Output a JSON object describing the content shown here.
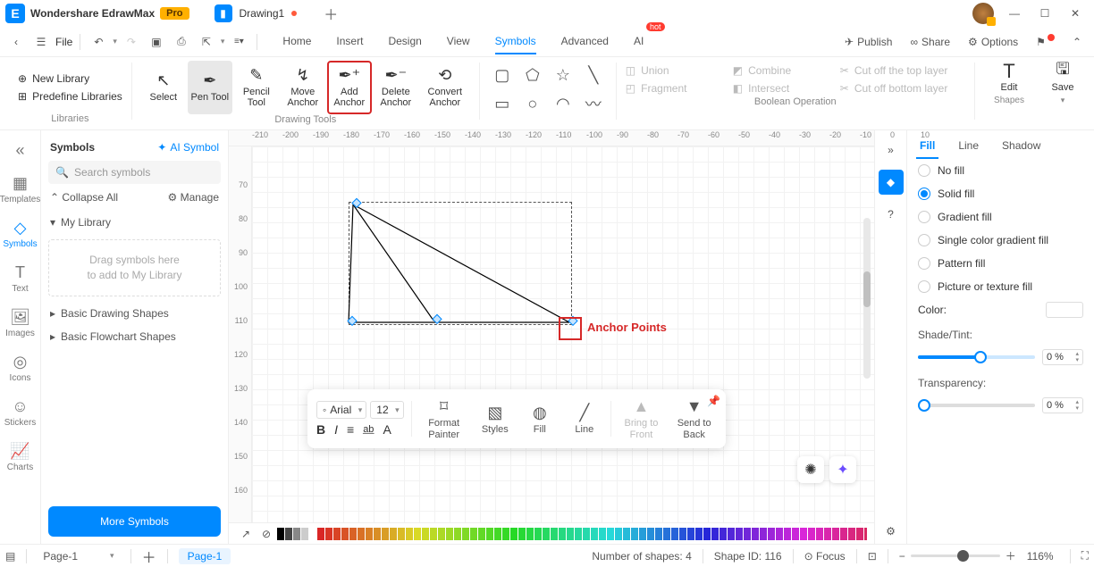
{
  "titlebar": {
    "app": "Wondershare EdrawMax",
    "badge": "Pro",
    "tab": "Drawing1"
  },
  "menubar": {
    "file": "File",
    "tabs": [
      "Home",
      "Insert",
      "Design",
      "View",
      "Symbols",
      "Advanced",
      "AI"
    ],
    "active": "Symbols",
    "hot": "hot",
    "publish": "Publish",
    "share": "Share",
    "options": "Options"
  },
  "ribbon": {
    "libraries": {
      "title": "Libraries",
      "new": "New Library",
      "predefine": "Predefine Libraries"
    },
    "drawing_tools": {
      "title": "Drawing Tools",
      "select": "Select",
      "pen": "Pen Tool",
      "pencil": "Pencil Tool",
      "move": "Move Anchor",
      "add": "Add Anchor",
      "del": "Delete Anchor",
      "convert": "Convert Anchor"
    },
    "bool": {
      "title": "Boolean Operation",
      "union": "Union",
      "fragment": "Fragment",
      "combine": "Combine",
      "intersect": "Intersect",
      "cuttop": "Cut off the top layer",
      "cutbottom": "Cut off bottom layer"
    },
    "rtools": {
      "edit": "Edit",
      "shapes": "Shapes",
      "save": "Save"
    }
  },
  "vtabs": [
    "Templates",
    "Symbols",
    "Text",
    "Images",
    "Icons",
    "Stickers",
    "Charts"
  ],
  "side": {
    "title": "Symbols",
    "ai": "AI Symbol",
    "placeholder": "Search symbols",
    "collapse": "Collapse All",
    "manage": "Manage",
    "mylib": "My Library",
    "drop": "Drag symbols here\nto add to My Library",
    "basic": "Basic Drawing Shapes",
    "flow": "Basic Flowchart Shapes",
    "more": "More Symbols"
  },
  "canvas": {
    "h_ruler": [
      "-210",
      "-200",
      "-190",
      "-180",
      "-170",
      "-160",
      "-150",
      "-140",
      "-130",
      "-120",
      "-110",
      "-100",
      "-90",
      "-80",
      "-70",
      "-60",
      "-50",
      "-40",
      "-30",
      "-20",
      "-10",
      "0",
      "10"
    ],
    "v_ruler": [
      "",
      "70",
      "80",
      "90",
      "100",
      "110",
      "120",
      "130",
      "140",
      "150",
      "160"
    ],
    "anchor_label": "Anchor Points"
  },
  "float": {
    "font": "Arial",
    "size": "12",
    "format": "Format Painter",
    "styles": "Styles",
    "fill": "Fill",
    "line": "Line",
    "front": "Bring to Front",
    "back": "Send to Back"
  },
  "right": {
    "tabs": [
      "Fill",
      "Line",
      "Shadow"
    ],
    "nofill": "No fill",
    "solid": "Solid fill",
    "gradient": "Gradient fill",
    "single": "Single color gradient fill",
    "pattern": "Pattern fill",
    "picture": "Picture or texture fill",
    "color": "Color:",
    "shade": "Shade/Tint:",
    "trans": "Transparency:",
    "pct": "0 %"
  },
  "status": {
    "page_sel": "Page-1",
    "page_tab": "Page-1",
    "shapes": "Number of shapes: 4",
    "shapeid": "Shape ID: 116",
    "focus": "Focus",
    "zoom": "116%"
  }
}
